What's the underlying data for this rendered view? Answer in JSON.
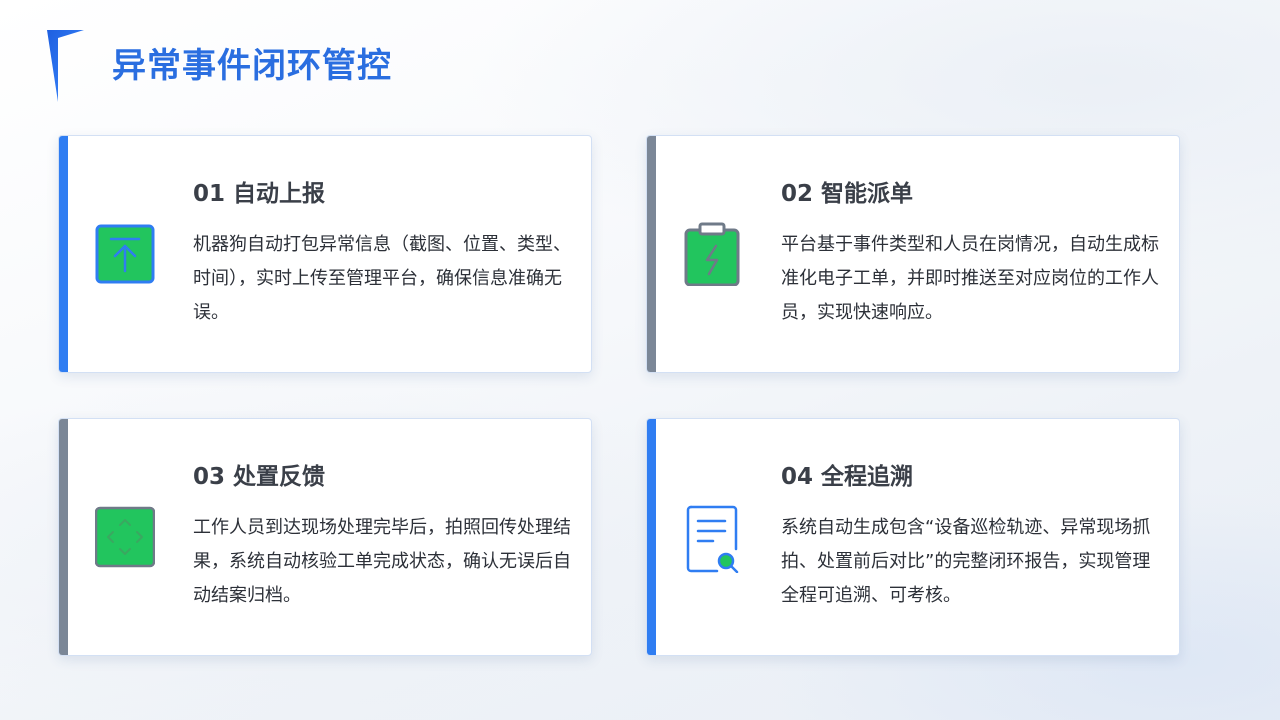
{
  "page": {
    "title": "异常事件闭环管控"
  },
  "colors": {
    "title": "#2a6ee0",
    "accent_blue": "#2f7df2",
    "accent_gray": "#7b8797",
    "icon_green": "#22c55e"
  },
  "cards": [
    {
      "heading": "01 自动上报",
      "body": "机器狗自动打包异常信息（截图、位置、类型、时间），实时上传至管理平台，确保信息准确无误。",
      "icon": "upload-icon",
      "accent": "blue"
    },
    {
      "heading": "02 智能派单",
      "body": "平台基于事件类型和人员在岗情况，自动生成标准化电子工单，并即时推送至对应岗位的工作人员，实现快速响应。",
      "icon": "clipboard-bolt-icon",
      "accent": "gray"
    },
    {
      "heading": "03 处置反馈",
      "body": "工作人员到达现场处理完毕后，拍照回传处理结果，系统自动核验工单完成状态，确认无误后自动结案归档。",
      "icon": "expand-arrows-icon",
      "accent": "gray"
    },
    {
      "heading": "04 全程追溯",
      "body": "系统自动生成包含“设备巡检轨迹、异常现场抓拍、处置前后对比”的完整闭环报告，实现管理全程可追溯、可考核。",
      "icon": "document-search-icon",
      "accent": "blue"
    }
  ]
}
